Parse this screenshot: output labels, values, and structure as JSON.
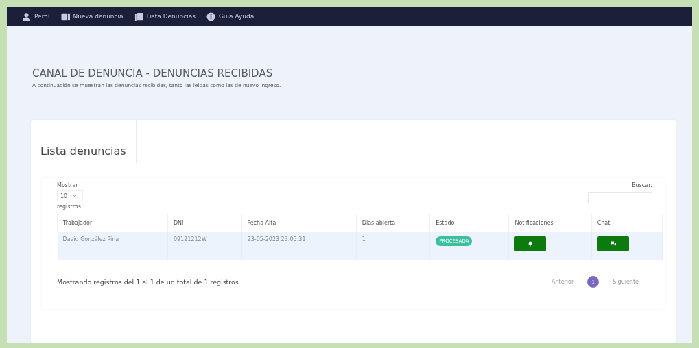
{
  "nav": [
    {
      "label": "Perfil"
    },
    {
      "label": "Nueva denuncia"
    },
    {
      "label": "Lista Denuncias"
    },
    {
      "label": "Guia Ayuda"
    }
  ],
  "title": "CANAL DE DENUNCIA - DENUNCIAS RECIBIDAS",
  "subtitle": "A continuación se muestran las denuncias recibidas, tanto las leidas como las de nuevo ingreso.",
  "card_title": "Lista denuncias",
  "length": {
    "before": "Mostrar",
    "value": "10",
    "after": "registros"
  },
  "search": {
    "label": "Buscar:"
  },
  "table": {
    "columns": [
      "Trabajador",
      "DNI",
      "Fecha Alta",
      "Dias abierta",
      "Estado",
      "Notificaciones",
      "Chat"
    ],
    "rows": [
      {
        "cells": [
          "David González Pina",
          "09121212W",
          "23-05-2023 23:05:31",
          "1"
        ],
        "status": "PROCESADA",
        "selected": true
      }
    ]
  },
  "info": "Mostrando registros del 1 al 1 de un total de 1 registros",
  "pagination": {
    "previous": "Anterior",
    "pages": [
      {
        "label": "1",
        "selected": true
      }
    ],
    "next": "Siguiente"
  }
}
